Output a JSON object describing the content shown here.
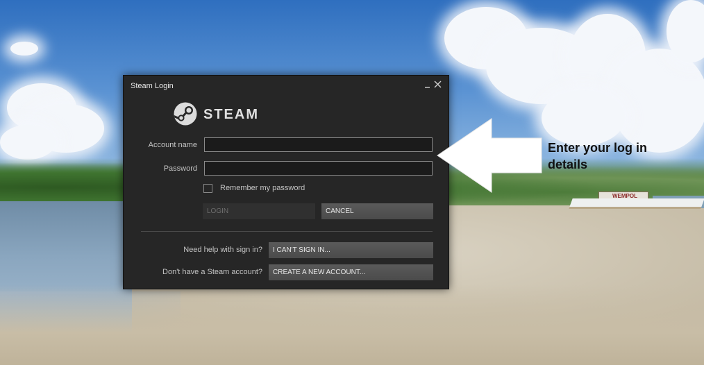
{
  "dialog": {
    "title": "Steam Login",
    "logo_text": "STEAM",
    "logo_tm": "™"
  },
  "form": {
    "account_label": "Account name",
    "account_value": "",
    "password_label": "Password",
    "password_value": "",
    "remember_label": "Remember my password",
    "remember_checked": false,
    "login_label": "LOGIN",
    "cancel_label": "CANCEL"
  },
  "help": {
    "signin_question": "Need help with sign in?",
    "signin_button": "I CAN'T SIGN IN...",
    "account_question": "Don't have a Steam account?",
    "account_button": "CREATE A NEW ACCOUNT..."
  },
  "annotation": {
    "text_line1": "Enter your log in",
    "text_line2": "details"
  },
  "background": {
    "boat_name": "WEMPOL"
  },
  "colors": {
    "dialog_bg": "#262626",
    "button_bg": "#4b4b4b",
    "disabled_text": "#6e6e6e"
  },
  "icons": {
    "minimize": "minimize-icon",
    "close": "close-icon",
    "logo": "steam-logo-icon",
    "arrow": "left-arrow-icon"
  }
}
